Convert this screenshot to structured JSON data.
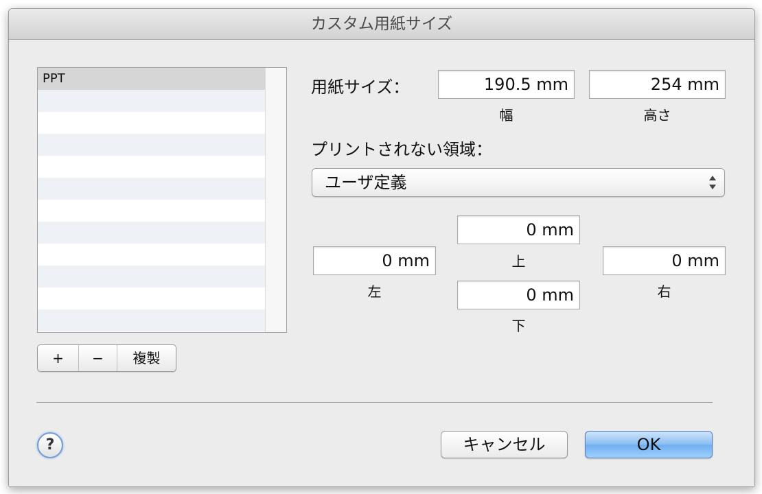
{
  "window": {
    "title": "カスタム用紙サイズ"
  },
  "paper_list": {
    "items": [
      "PPT",
      "",
      "",
      "",
      "",
      "",
      "",
      "",
      "",
      "",
      "",
      ""
    ],
    "selected_index": 0
  },
  "list_controls": {
    "add_label": "+",
    "remove_label": "−",
    "duplicate_label": "複製"
  },
  "paper_size": {
    "label": "用紙サイズ：",
    "width_value": "190.5 mm",
    "width_label": "幅",
    "height_value": "254 mm",
    "height_label": "高さ"
  },
  "non_printable": {
    "label": "プリントされない領域：",
    "selected_option": "ユーザ定義",
    "top_value": "0 mm",
    "top_label": "上",
    "left_value": "0 mm",
    "left_label": "左",
    "right_value": "0 mm",
    "right_label": "右",
    "bottom_value": "0 mm",
    "bottom_label": "下"
  },
  "footer": {
    "help_label": "?",
    "cancel_label": "キャンセル",
    "ok_label": "OK"
  },
  "colors": {
    "accent": "#6eaef0",
    "window_bg": "#ececec"
  }
}
